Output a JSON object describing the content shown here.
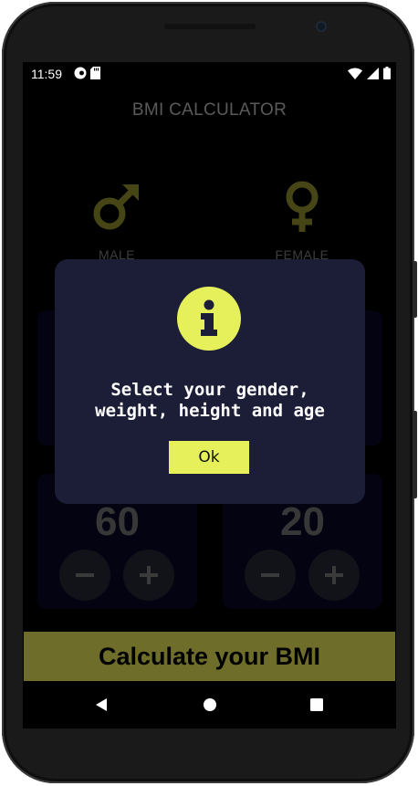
{
  "status_bar": {
    "time": "11:59"
  },
  "app": {
    "title": "BMI CALCULATOR"
  },
  "gender": {
    "male_label": "MALE",
    "female_label": "FEMALE"
  },
  "weight": {
    "value": "60"
  },
  "age": {
    "value": "20"
  },
  "calculate_button": {
    "label": "Calculate your BMI"
  },
  "dialog": {
    "icon": "info-icon",
    "message_line1": "Select your gender,",
    "message_line2": "weight, height and age",
    "ok_label": "Ok"
  },
  "colors": {
    "accent": "#e6f05a",
    "button_bg": "#6e6d2a",
    "card_bg": "#05061c",
    "dialog_bg": "#1c1e37",
    "gender_icon": "#6a6b22"
  }
}
